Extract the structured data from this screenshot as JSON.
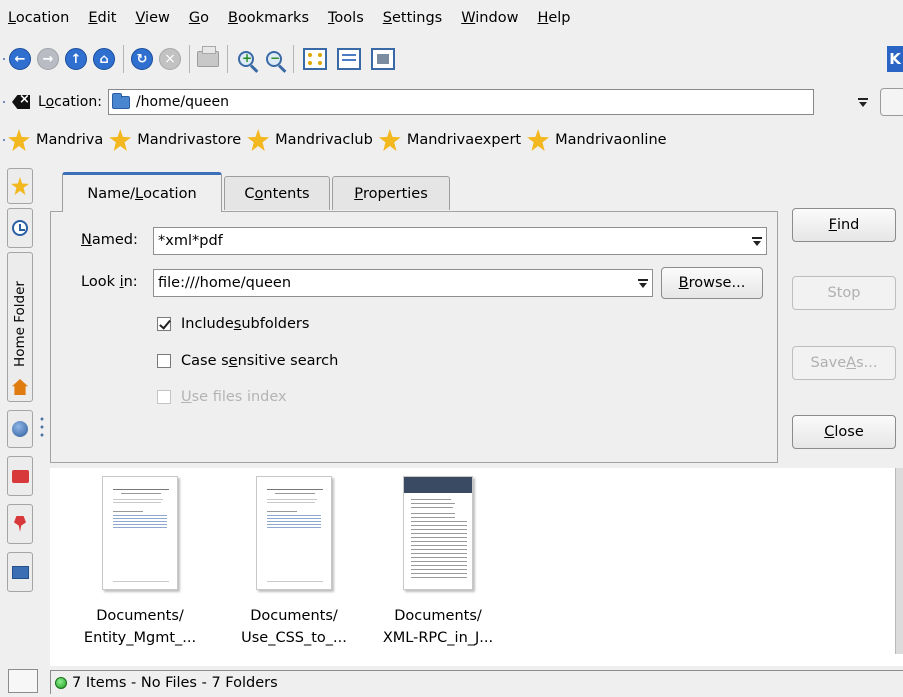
{
  "menubar": {
    "items": [
      {
        "pre": "",
        "u": "L",
        "post": "ocation"
      },
      {
        "pre": "",
        "u": "E",
        "post": "dit"
      },
      {
        "pre": "",
        "u": "V",
        "post": "iew"
      },
      {
        "pre": "",
        "u": "G",
        "post": "o"
      },
      {
        "pre": "",
        "u": "B",
        "post": "ookmarks"
      },
      {
        "pre": "",
        "u": "T",
        "post": "ools"
      },
      {
        "pre": "",
        "u": "S",
        "post": "ettings"
      },
      {
        "pre": "",
        "u": "W",
        "post": "indow"
      },
      {
        "pre": "",
        "u": "H",
        "post": "elp"
      }
    ]
  },
  "toolbar": {
    "icons": [
      "back-icon",
      "forward-icon",
      "up-icon",
      "home-icon",
      "reload-icon",
      "stop-icon",
      "print-icon",
      "zoom-in-icon",
      "zoom-out-icon",
      "icon-view-icon",
      "list-view-icon",
      "preview-view-icon",
      "kde-logo-icon"
    ]
  },
  "location": {
    "label_pre": "L",
    "label_u": "o",
    "label_post": "cation:",
    "value": "/home/queen"
  },
  "bookmarks": [
    "Mandriva",
    "Mandrivastore",
    "Mandrivaclub",
    "Mandrivaexpert",
    "Mandrivaonline"
  ],
  "sidebar": {
    "home_folder_label": "Home Folder"
  },
  "find": {
    "tabs": [
      {
        "pre": "Name/",
        "u": "L",
        "post": "ocation"
      },
      {
        "pre": "C",
        "u": "o",
        "post": "ntents"
      },
      {
        "pre": "",
        "u": "P",
        "post": "roperties"
      }
    ],
    "named": {
      "pre": "",
      "u": "N",
      "post": "amed:",
      "value": "*xml*pdf"
    },
    "lookin": {
      "pre": "Look ",
      "u": "i",
      "post": "n:",
      "value": "file:///home/queen"
    },
    "browse": {
      "pre": "",
      "u": "B",
      "post": "rowse..."
    },
    "include_subfolders": {
      "pre": "Include ",
      "u": "s",
      "post": "ubfolders",
      "checked": true
    },
    "case_sensitive": {
      "pre": "Case s",
      "u": "e",
      "post": "nsitive search",
      "checked": false
    },
    "use_index": {
      "pre": "",
      "u": "U",
      "post": "se files index",
      "checked": false,
      "disabled": true
    },
    "buttons": {
      "find": {
        "pre": "",
        "u": "F",
        "post": "ind"
      },
      "stop": {
        "label": "Stop"
      },
      "save_as": {
        "pre": "Save ",
        "u": "A",
        "post": "s..."
      },
      "close": {
        "pre": "",
        "u": "C",
        "post": "lose"
      }
    }
  },
  "results": [
    {
      "line1": "Documents/",
      "line2": "Entity_Mgmt_..."
    },
    {
      "line1": "Documents/",
      "line2": "Use_CSS_to_..."
    },
    {
      "line1": "Documents/",
      "line2": "XML-RPC_in_J..."
    }
  ],
  "status": {
    "text": "7 Items - No Files - 7 Folders"
  }
}
